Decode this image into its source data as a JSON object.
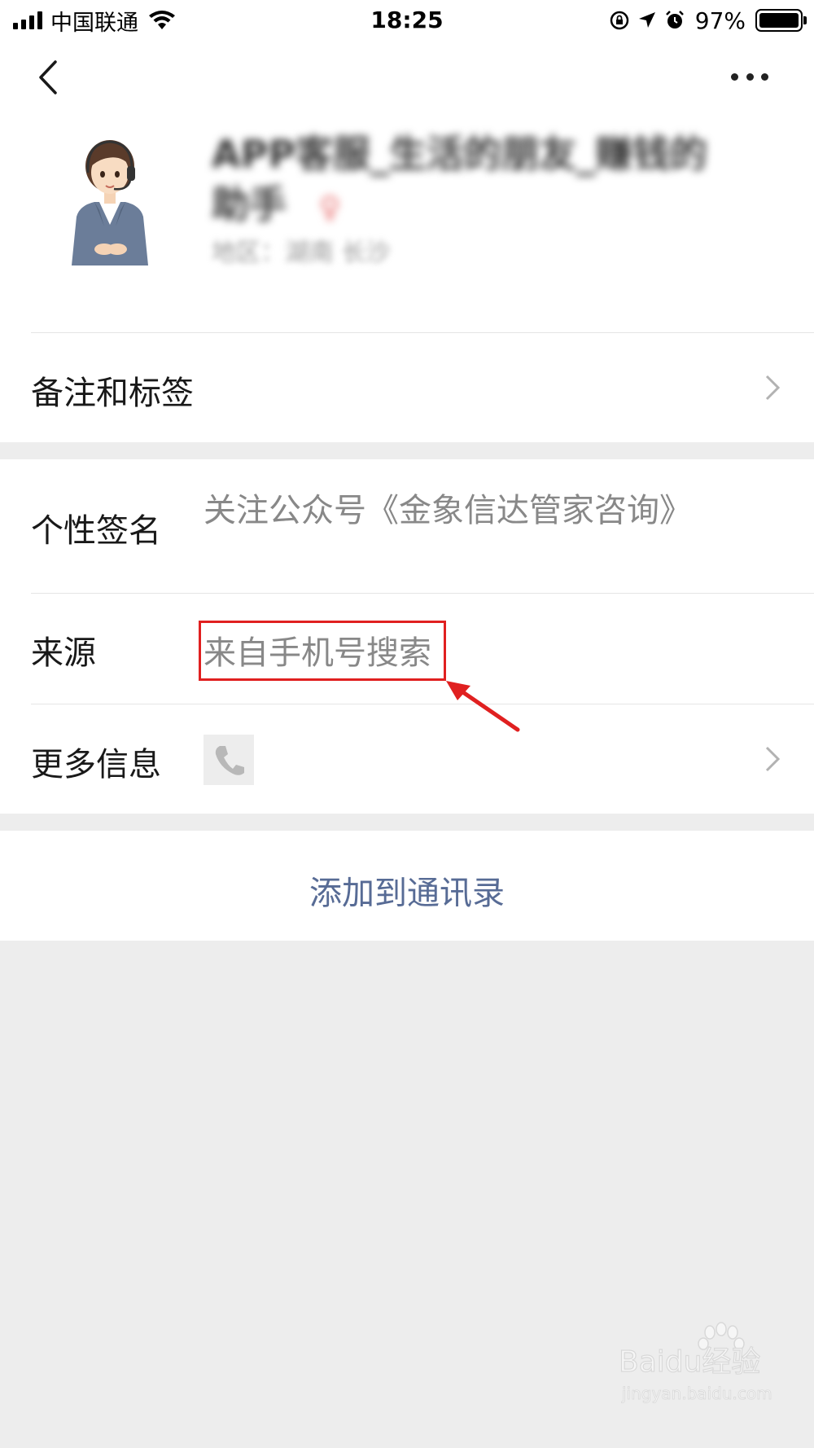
{
  "status_bar": {
    "carrier": "中国联通",
    "time": "18:25",
    "battery": "97%"
  },
  "nav": {
    "back_icon": "chevron-left-icon",
    "more_icon": "more-dots-icon"
  },
  "profile": {
    "name": "APP客服_生活的朋友_赚钱的助手",
    "gender_mark": "♀",
    "wxid": "地区：湖南 长沙"
  },
  "cells": {
    "remark_label": "备注和标签",
    "signature_label": "个性签名",
    "signature_value": "关注公众号《金象信达管家咨询》",
    "source_label": "来源",
    "source_value": "来自手机号搜索",
    "more_info_label": "更多信息"
  },
  "actions": {
    "add_contact": "添加到通讯录"
  },
  "watermark": {
    "brand": "Baidu经验",
    "url": "jingyan.baidu.com"
  },
  "colors": {
    "link_blue": "#576b95",
    "highlight_red": "#e02020",
    "background": "#ededed"
  }
}
